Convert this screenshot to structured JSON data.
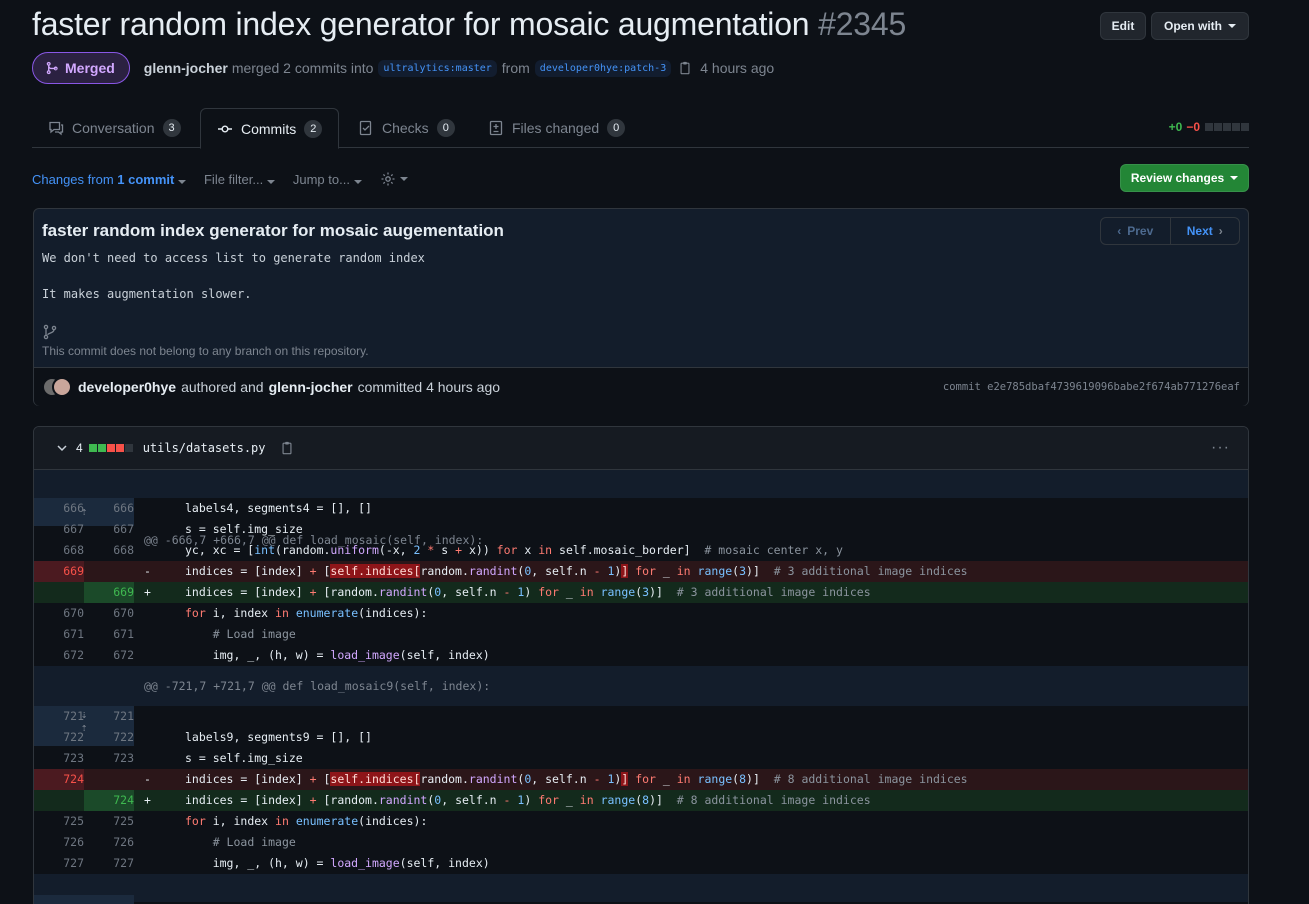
{
  "header": {
    "title": "faster random index generator for mosaic augmentation",
    "number": "#2345",
    "edit_label": "Edit",
    "open_with_label": "Open with",
    "state_label": "Merged",
    "author": "glenn-jocher",
    "merge_text": "merged 2 commits into",
    "base_branch": "ultralytics:master",
    "from_text": "from",
    "head_branch": "developer0hye:patch-3",
    "time": "4 hours ago"
  },
  "tabs": [
    {
      "label": "Conversation",
      "count": "3"
    },
    {
      "label": "Commits",
      "count": "2"
    },
    {
      "label": "Checks",
      "count": "0"
    },
    {
      "label": "Files changed",
      "count": "0"
    }
  ],
  "diffstat": {
    "additions": "+0",
    "deletions": "−0"
  },
  "toolbar": {
    "changes_prefix": "Changes from",
    "changes_count": "1 commit",
    "file_filter": "File filter...",
    "jump_to": "Jump to...",
    "review_label": "Review changes"
  },
  "commit": {
    "title": "faster random index generator for mosaic augementation",
    "body_line1": "We don't need to access list to generate random index",
    "body_line2": "It makes augmentation slower.",
    "prev_label": "Prev",
    "next_label": "Next",
    "branch_note": "This commit does not belong to any branch on this repository.",
    "author": "developer0hye",
    "authored_text": "authored and",
    "committer": "glenn-jocher",
    "committed_text": "committed 4 hours ago",
    "sha": "commit e2e785dbaf4739619096babe2f674ab771276eaf"
  },
  "file": {
    "changes": "4",
    "path": "utils/datasets.py",
    "hunk1_header": "@@ -666,7 +666,7 @@ def load_mosaic(self, index):",
    "hunk2_header": "@@ -721,7 +721,7 @@ def load_mosaic9(self, index):",
    "ln": {
      "a666": "666",
      "a667": "667",
      "a668": "668",
      "a669": "669",
      "a670": "670",
      "a671": "671",
      "a672": "672",
      "a721": "721",
      "a722": "722",
      "a723": "723",
      "a724": "724",
      "a725": "725",
      "a726": "726",
      "a727": "727"
    }
  },
  "colors": {
    "background": "#0d1117",
    "merged": "#8957e5",
    "link": "#4493f8",
    "addition": "#3fb950",
    "deletion": "#f85149",
    "primary_button": "#238636"
  }
}
